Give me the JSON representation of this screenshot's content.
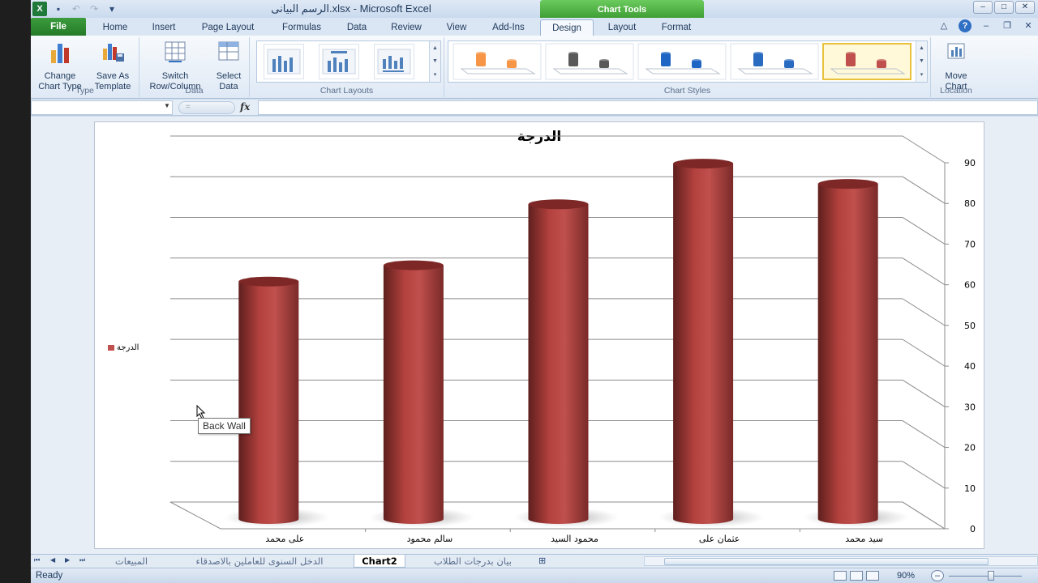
{
  "window": {
    "title": "الرسم البيانى.xlsx - Microsoft Excel",
    "chart_tools_label": "Chart Tools",
    "app_icon_letter": "X"
  },
  "tabs": [
    "File",
    "Home",
    "Insert",
    "Page Layout",
    "Formulas",
    "Data",
    "Review",
    "View",
    "Add-Ins",
    "Design",
    "Layout",
    "Format"
  ],
  "active_tab": "Design",
  "ribbon": {
    "type_group": {
      "label": "Type",
      "change_chart_type": [
        "Change",
        "Chart Type"
      ],
      "save_as_template": [
        "Save As",
        "Template"
      ]
    },
    "data_group": {
      "label": "Data",
      "switch_row_column": [
        "Switch",
        "Row/Column"
      ],
      "select_data": [
        "Select",
        "Data"
      ]
    },
    "layouts_group": {
      "label": "Chart Layouts"
    },
    "styles_group": {
      "label": "Chart Styles",
      "swatches": [
        "#f79646",
        "#595959",
        "#1f66c4",
        "#2a6bc2",
        "#c0504d"
      ]
    },
    "location_group": {
      "label": "Location",
      "move_chart": [
        "Move",
        "Chart"
      ]
    }
  },
  "formula_bar": {
    "fx": "fx",
    "name_box_value": "",
    "formula": ""
  },
  "chart_data": {
    "type": "bar",
    "title": "الدرجة",
    "categories": [
      "على محمد",
      "سالم محمود",
      "محمود السيد",
      "عثمان على",
      "سيد محمد"
    ],
    "series": [
      {
        "name": "الدرجة",
        "values": [
          58,
          62,
          77,
          87,
          82
        ],
        "color": "#c0504d"
      }
    ],
    "ylim": [
      0,
      90
    ],
    "yticks": [
      0,
      10,
      20,
      30,
      40,
      50,
      60,
      70,
      80,
      90
    ],
    "legend_position": "left",
    "grid": true
  },
  "tooltip": "Back Wall",
  "sheet_tabs": [
    "المبيعات",
    "الدخل السنوى للعاملين بالاصدقاء",
    "Chart2",
    "بيان بدرجات الطلاب"
  ],
  "active_sheet": "Chart2",
  "status": {
    "ready": "Ready",
    "zoom": "90%"
  }
}
